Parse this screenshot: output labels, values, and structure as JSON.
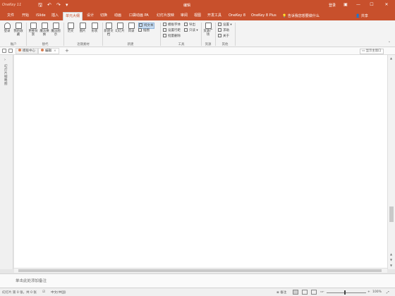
{
  "titlebar": {
    "logo": "OneKey 11",
    "qa_save_icon": "save-icon",
    "qa_undo_icon": "undo-icon",
    "qa_redo_icon": "redo-icon",
    "doc_title": "编辑",
    "login": "登录",
    "ribbon_options_icon": "ribbon-display-icon",
    "minimize": "—",
    "maximize": "☐",
    "close": "✕"
  },
  "tabs": [
    {
      "label": "文件"
    },
    {
      "label": "开始"
    },
    {
      "label": "iSlide"
    },
    {
      "label": "插入"
    },
    {
      "label": "单元大纲"
    },
    {
      "label": "设计"
    },
    {
      "label": "切换"
    },
    {
      "label": "动画"
    },
    {
      "label": "口袋动画 PA"
    },
    {
      "label": "幻灯片放映"
    },
    {
      "label": "审阅"
    },
    {
      "label": "视图"
    },
    {
      "label": "开发工具"
    },
    {
      "label": "OneKey 8"
    },
    {
      "label": "OneKey 8 Plus"
    }
  ],
  "tell_me": "告诉我您想要做什么",
  "share": "共享",
  "ribbon": {
    "account": {
      "label": "账户",
      "buttons": [
        "登录",
        "我的收藏"
      ]
    },
    "replace": {
      "label": "替代",
      "buttons": [
        "更换背景",
        "魔法换换",
        "魔法图示"
      ]
    },
    "recent": {
      "label": "近期素材",
      "buttons": [
        "范文",
        "图片",
        "形状"
      ]
    },
    "new": {
      "label": "新建",
      "buttons": [
        "新建文档",
        "幻灯片",
        "目录"
      ],
      "small": [
        "纯文本",
        "插图"
      ]
    },
    "tools": {
      "label": "工具",
      "small": [
        "模板字体",
        "设置行距",
        "批量删除",
        "导出",
        "只读"
      ]
    },
    "resource": {
      "label": "资源",
      "buttons": [
        "资源广场"
      ]
    },
    "other": {
      "label": "其他",
      "small": [
        "设置",
        "求助",
        "关于"
      ]
    }
  },
  "doc_tabs": {
    "items": [
      {
        "label": "模板中心"
      },
      {
        "label": "编辑"
      }
    ],
    "add": "+",
    "show_main": "显示主窗口"
  },
  "outline_label": "幻灯片缩略图",
  "notes_placeholder": "单击此处添加备注",
  "status": {
    "slide_info": "幻灯片 第 0 张，共 0 张",
    "language": "中文(中国)",
    "notes": "备注",
    "zoom_minus": "-",
    "zoom_plus": "+",
    "zoom": "100%"
  },
  "colors": {
    "accent": "#c8502c",
    "ribbon_bg": "#f3f3f3"
  }
}
